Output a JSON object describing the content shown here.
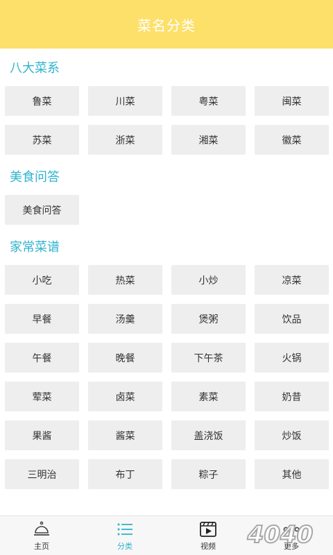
{
  "header": {
    "title": "菜名分类"
  },
  "sections": [
    {
      "title": "八大菜系",
      "items": [
        "鲁菜",
        "川菜",
        "粤菜",
        "闽菜",
        "苏菜",
        "浙菜",
        "湘菜",
        "徽菜"
      ]
    },
    {
      "title": "美食问答",
      "items": [
        "美食问答"
      ]
    },
    {
      "title": "家常菜谱",
      "items": [
        "小吃",
        "热菜",
        "小炒",
        "凉菜",
        "早餐",
        "汤羹",
        "煲粥",
        "饮品",
        "午餐",
        "晚餐",
        "下午茶",
        "火锅",
        "荤菜",
        "卤菜",
        "素菜",
        "奶昔",
        "果酱",
        "酱菜",
        "盖浇饭",
        "炒饭",
        "三明治",
        "布丁",
        "粽子",
        "其他"
      ]
    }
  ],
  "tabbar": {
    "tabs": [
      {
        "label": "主页",
        "icon": "cloche-icon",
        "active": false
      },
      {
        "label": "分类",
        "icon": "list-icon",
        "active": true
      },
      {
        "label": "视频",
        "icon": "video-icon",
        "active": false
      },
      {
        "label": "更多",
        "icon": "more-icon",
        "active": false
      }
    ]
  },
  "watermark": {
    "text": "4040"
  },
  "colors": {
    "header": "#fde06a",
    "accent": "#2fb3cf",
    "cell": "#eeeeee"
  }
}
